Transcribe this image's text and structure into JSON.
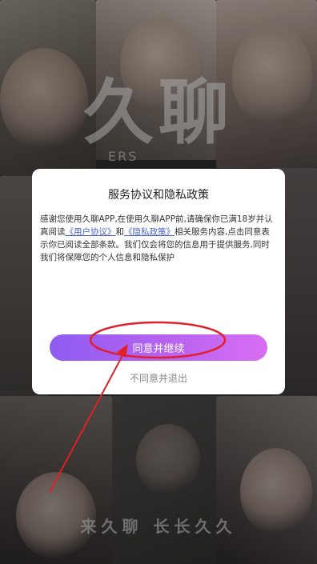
{
  "background": {
    "logo_text": "久聊",
    "caption_text": "ERS",
    "slogan": "来久聊 长长久久"
  },
  "dialog": {
    "title": "服务协议和隐私政策",
    "body_prefix": "感谢您使用久聊APP,在使用久聊APP前,请确保你已满18岁并认真阅读",
    "user_agreement_link": "《用户协议》",
    "and_text": "和",
    "privacy_policy_link": "《隐私政策》",
    "body_suffix": "相关服务内容,点击同意表示你已阅读全部条款。我们仅会将您的信息用于提供服务,同时我们将保障您的个人信息和隐私保护",
    "agree_button": "同意并继续",
    "disagree_button": "不同意并退出"
  },
  "colors": {
    "button_gradient_start": "#8e5cf2",
    "button_gradient_end": "#d86ef2",
    "link": "#4a63d6",
    "annotation": "#e0202a"
  }
}
